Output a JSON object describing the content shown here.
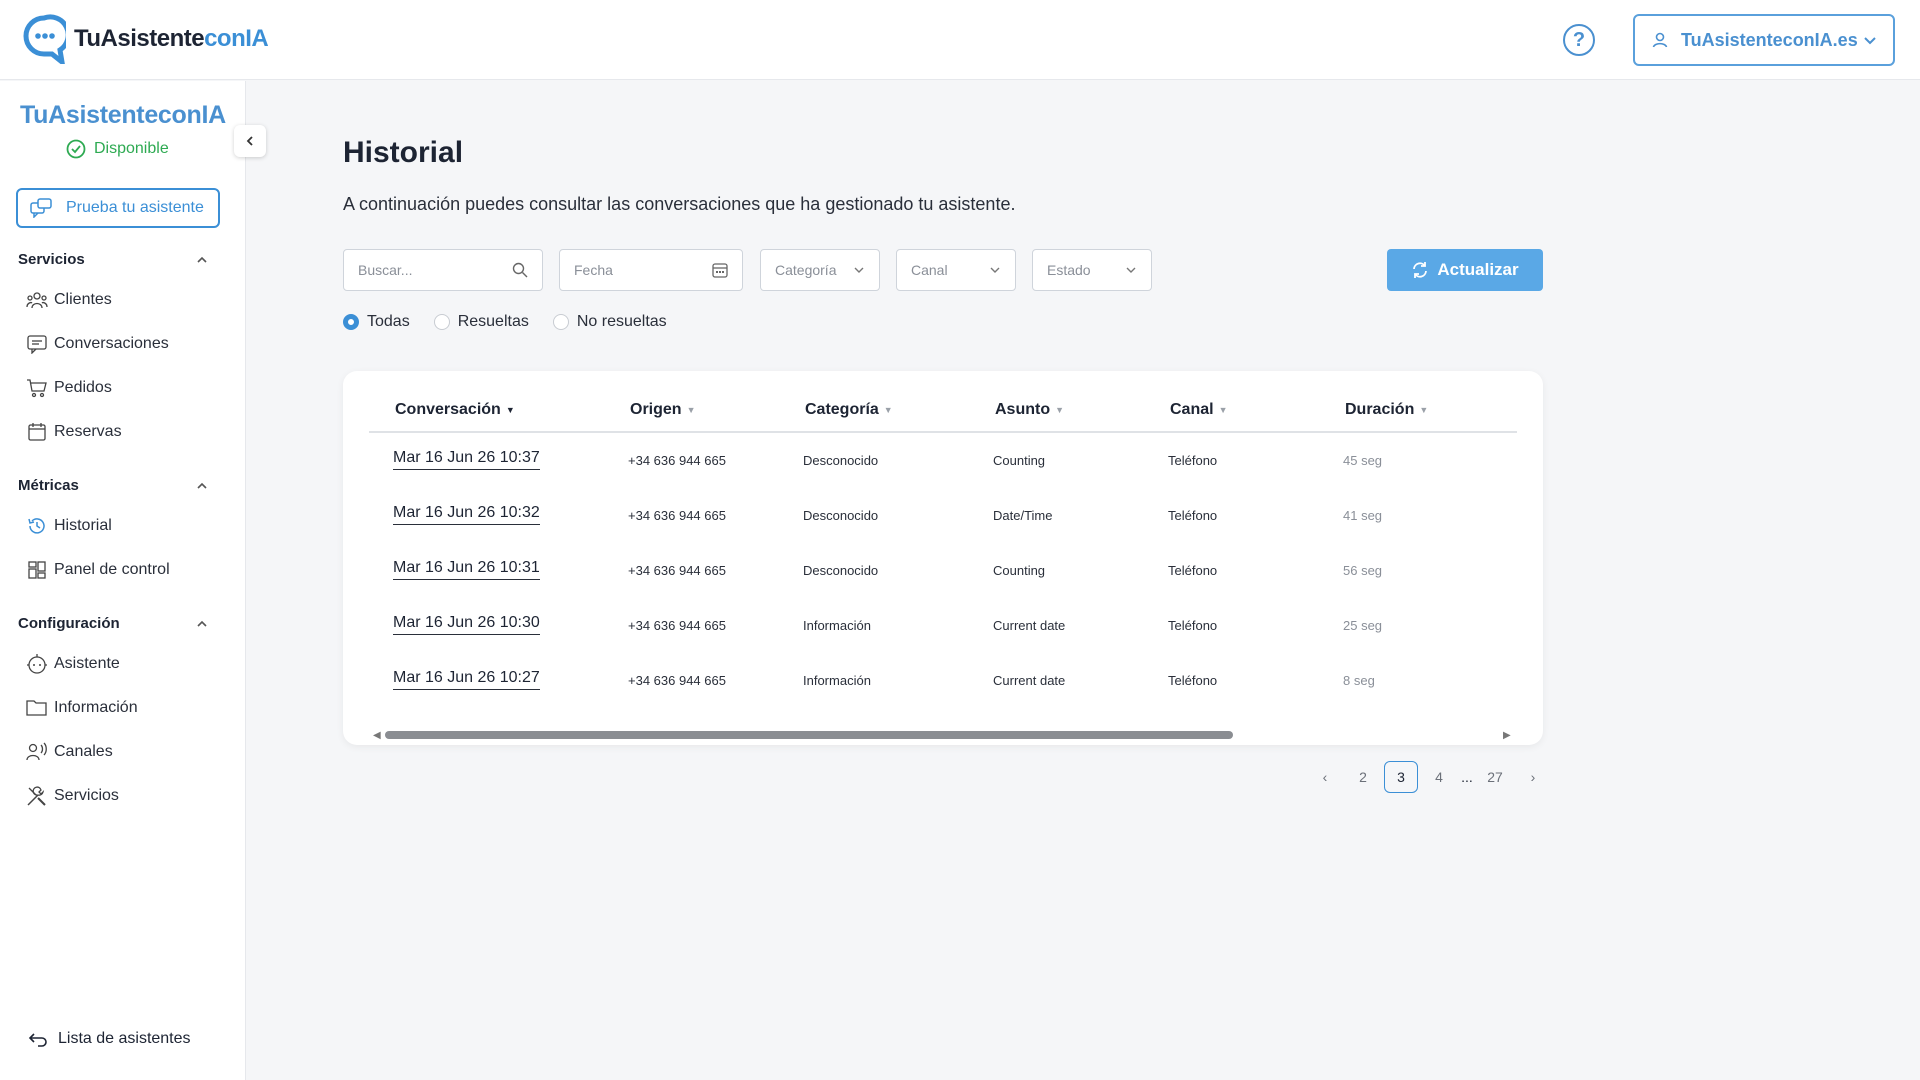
{
  "header": {
    "logo_text_dark": "TuAsistente",
    "logo_text_blue": "conIA",
    "account_label": "TuAsistenteconIA.es"
  },
  "sidebar": {
    "brand_name": "TuAsistenteconIA",
    "status": "Disponible",
    "try_button": "Prueba tu asistente",
    "sections": [
      {
        "title": "Servicios",
        "items": [
          "Clientes",
          "Conversaciones",
          "Pedidos",
          "Reservas"
        ]
      },
      {
        "title": "Métricas",
        "items": [
          "Historial",
          "Panel de control"
        ]
      },
      {
        "title": "Configuración",
        "items": [
          "Asistente",
          "Información",
          "Canales",
          "Servicios"
        ]
      }
    ],
    "back_link": "Lista de asistentes"
  },
  "main": {
    "title": "Historial",
    "description": "A continuación puedes consultar las conversaciones que ha gestionado tu asistente.",
    "filters": {
      "search_placeholder": "Buscar...",
      "date_placeholder": "Fecha",
      "category": "Categoría",
      "channel": "Canal",
      "status": "Estado"
    },
    "refresh_button": "Actualizar",
    "radios": [
      {
        "label": "Todas",
        "selected": true
      },
      {
        "label": "Resueltas",
        "selected": false
      },
      {
        "label": "No resueltas",
        "selected": false
      }
    ],
    "table": {
      "columns": [
        "Conversación",
        "Origen",
        "Categoría",
        "Asunto",
        "Canal",
        "Duración"
      ],
      "rows": [
        [
          "Mar 16 Jun 26 10:37",
          "+34 636 944 665",
          "Desconocido",
          "Counting",
          "Teléfono",
          "45 seg"
        ],
        [
          "Mar 16 Jun 26 10:32",
          "+34 636 944 665",
          "Desconocido",
          "Date/Time",
          "Teléfono",
          "41 seg"
        ],
        [
          "Mar 16 Jun 26 10:31",
          "+34 636 944 665",
          "Desconocido",
          "Counting",
          "Teléfono",
          "56 seg"
        ],
        [
          "Mar 16 Jun 26 10:30",
          "+34 636 944 665",
          "Información",
          "Current date",
          "Teléfono",
          "25 seg"
        ],
        [
          "Mar 16 Jun 26 10:27",
          "+34 636 944 665",
          "Información",
          "Current date",
          "Teléfono",
          "8 seg"
        ]
      ]
    },
    "pagination": {
      "prev": "‹",
      "pages": [
        "2",
        "3",
        "4"
      ],
      "ellipsis": "...",
      "last": "27",
      "next": "›",
      "current": "3"
    }
  },
  "colors": {
    "accent": "#3b8fd6",
    "status_green": "#2eaa52",
    "refresh_bg": "#5aa8e6"
  }
}
